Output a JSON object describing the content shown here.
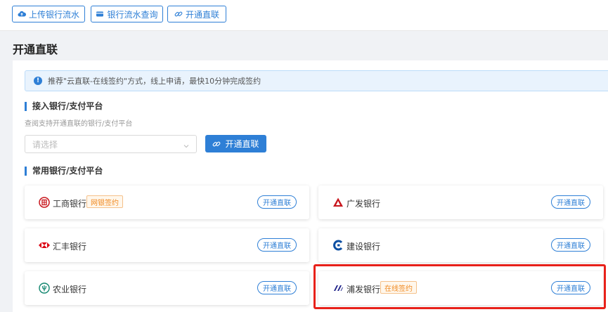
{
  "toolbar": {
    "upload_label": "上传银行流水",
    "query_label": "银行流水查询",
    "open_label": "开通直联"
  },
  "page": {
    "title": "开通直联"
  },
  "notice": {
    "text": "推荐\"云直联-在线签约\"方式，线上申请，最快10分钟完成签约"
  },
  "access": {
    "title": "接入银行/支付平台",
    "subtitle": "查阅支持开通直联的银行/支付平台",
    "placeholder": "请选择",
    "button_label": "开通直联"
  },
  "common": {
    "title": "常用银行/支付平台",
    "banks": [
      {
        "name": "工商银行",
        "badge": "网银签约",
        "button": "开通直联",
        "icon": "icbc-logo"
      },
      {
        "name": "广发银行",
        "badge": "",
        "button": "开通直联",
        "icon": "cgb-logo"
      },
      {
        "name": "汇丰银行",
        "badge": "",
        "button": "开通直联",
        "icon": "hsbc-logo"
      },
      {
        "name": "建设银行",
        "badge": "",
        "button": "开通直联",
        "icon": "ccb-logo"
      },
      {
        "name": "农业银行",
        "badge": "",
        "button": "开通直联",
        "icon": "abc-logo"
      },
      {
        "name": "浦发银行",
        "badge": "在线签约",
        "button": "开通直联",
        "icon": "spdb-logo"
      }
    ]
  },
  "colors": {
    "primary": "#2e7fd6",
    "badge_orange": "#f08a22",
    "highlight_red": "#e8211a"
  }
}
